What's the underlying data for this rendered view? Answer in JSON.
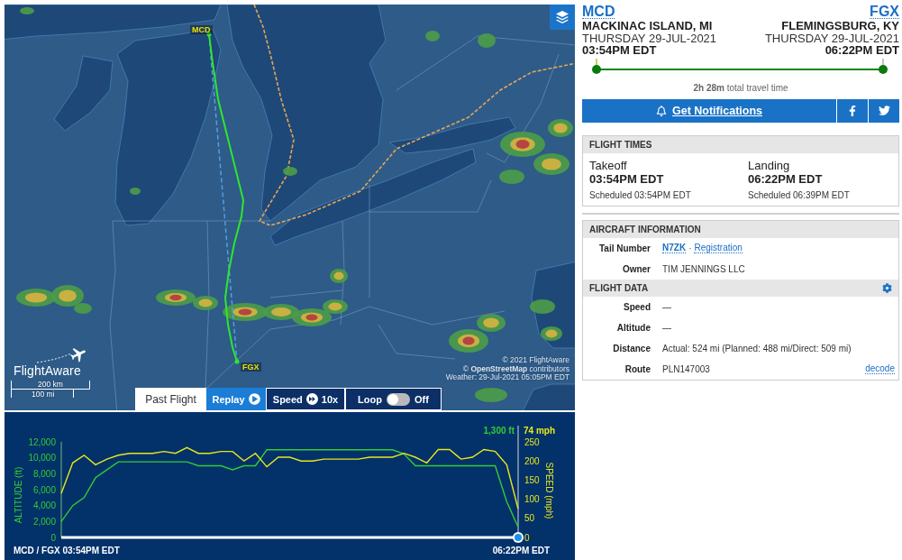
{
  "map": {
    "origin_label": "MCD",
    "destination_label": "FGX",
    "logo": "FlightAware",
    "scale": {
      "metric": "200 km",
      "imperial": "100 mi"
    },
    "attribution": [
      "© 2021 FlightAware",
      "© **OpenStreetMap** contributors",
      "Weather: 29-Jul-2021 05:05PM EDT"
    ]
  },
  "playback": {
    "mode": "Past Flight",
    "replay": "Replay",
    "speed_label": "Speed",
    "speed": "10x",
    "loop_label": "Loop",
    "loop": {
      "on": false,
      "text": "Off"
    }
  },
  "chart": {
    "readouts": [
      "1,300 ft",
      "74 mph"
    ],
    "start_label": "MCD / FGX 03:54PM EDT",
    "end_label": "06:22PM EDT",
    "timeline": {
      "level": 1
    },
    "chart_data": {
      "type": "line",
      "ylabel": "ALTITUDE (ft)",
      "ylim": [
        0,
        12000
      ],
      "yticks": [
        {
          "value": 0,
          "label": "0"
        },
        {
          "value": 2000,
          "label": "2,000"
        },
        {
          "value": 4000,
          "label": "4,000"
        },
        {
          "value": 6000,
          "label": "6,000"
        },
        {
          "value": 8000,
          "label": "8,000"
        },
        {
          "value": 10000,
          "label": "10,000"
        },
        {
          "value": 12000,
          "label": "12,000"
        }
      ],
      "y2label": "SPEED (mph)",
      "y2lim": [
        0,
        250
      ],
      "y2ticks": [
        0,
        50,
        100,
        150,
        200,
        250
      ],
      "series": [
        {
          "axis": "y",
          "color": "#33cc33",
          "values": [
            2000,
            4000,
            5000,
            7500,
            8500,
            9500,
            9500,
            9500,
            9500,
            9500,
            9500,
            9500,
            9000,
            9000,
            9000,
            8500,
            9000,
            9000,
            11000,
            11000,
            11000,
            11000,
            11000,
            11000,
            11000,
            11000,
            11000,
            11000,
            11000,
            11000,
            10500,
            9000,
            9000,
            9000,
            9000,
            9000,
            9000,
            9000,
            9000,
            4500,
            1300
          ]
        },
        {
          "axis": "y2",
          "color": "#e8e81a",
          "values": [
            115,
            195,
            215,
            190,
            205,
            215,
            220,
            220,
            220,
            225,
            220,
            235,
            220,
            220,
            225,
            225,
            200,
            220,
            185,
            210,
            210,
            200,
            200,
            205,
            205,
            205,
            205,
            210,
            210,
            210,
            220,
            210,
            195,
            230,
            230,
            205,
            210,
            230,
            225,
            190,
            75
          ]
        }
      ]
    }
  },
  "route": {
    "origin": {
      "code": "MCD",
      "city": "MACKINAC ISLAND, MI",
      "date": "THURSDAY 29-JUL-2021",
      "time": "03:54PM EDT"
    },
    "destination": {
      "code": "FGX",
      "city": "FLEMINGSBURG, KY",
      "date": "THURSDAY 29-JUL-2021",
      "time": "06:22PM EDT"
    },
    "progress": {
      "level": 1
    },
    "travel_time": "**2h 28m** total travel time"
  },
  "notifications": {
    "label": "Get Notifications"
  },
  "flight_times": {
    "title": "FLIGHT TIMES",
    "columns": [
      {
        "label": "Takeoff",
        "time": "03:54PM EDT",
        "scheduled": "Scheduled 03:54PM EDT"
      },
      {
        "label": "Landing",
        "time": "06:22PM EDT",
        "scheduled": "Scheduled 06:39PM EDT"
      }
    ]
  },
  "aircraft_information": {
    "title": "AIRCRAFT INFORMATION",
    "rows": [
      {
        "kind": "links",
        "label": "Tail Number",
        "links": [
          "N7ZK",
          "Registration"
        ],
        "separator": "·"
      },
      {
        "kind": "text",
        "label": "Owner",
        "value": "TIM JENNINGS LLC"
      }
    ]
  },
  "flight_data": {
    "title": "FLIGHT DATA",
    "rows": [
      {
        "kind": "text",
        "label": "Speed",
        "value": "—"
      },
      {
        "kind": "text",
        "label": "Altitude",
        "value": "—"
      },
      {
        "kind": "text",
        "label": "Distance",
        "value": "Actual: 524 mi (Planned: 488 mi/Direct: 509 mi)"
      },
      {
        "kind": "text",
        "label": "Route",
        "value": "PLN147003",
        "link": "decode"
      }
    ]
  }
}
